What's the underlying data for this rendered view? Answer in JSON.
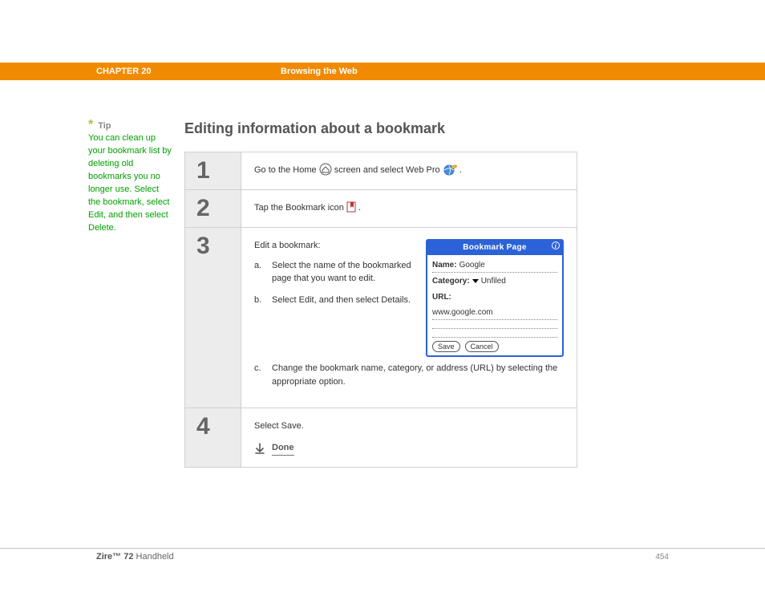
{
  "header": {
    "chapter": "CHAPTER 20",
    "section": "Browsing the Web"
  },
  "tip": {
    "label": "Tip",
    "body": "You can clean up your bookmark list by deleting old bookmarks you no longer use. Select the bookmark, select Edit, and then select Delete."
  },
  "title": "Editing information about a bookmark",
  "steps": {
    "s1": {
      "num": "1",
      "before": "Go to the Home ",
      "after1": " screen and select Web Pro ",
      "after2": "."
    },
    "s2": {
      "num": "2",
      "before": "Tap the Bookmark icon ",
      "after": "."
    },
    "s3": {
      "num": "3",
      "intro": "Edit a bookmark:",
      "a": {
        "lbl": "a.",
        "txt": "Select the name of the bookmarked page that you want to edit."
      },
      "b": {
        "lbl": "b.",
        "txt": "Select Edit, and then select Details."
      },
      "c": {
        "lbl": "c.",
        "txt": "Change the bookmark name, category, or address (URL) by selecting the appropriate option."
      }
    },
    "s4": {
      "num": "4",
      "text": "Select Save.",
      "done": "Done"
    }
  },
  "dialog": {
    "title": "Bookmark Page",
    "name_label": "Name:",
    "name_value": "Google",
    "category_label": "Category:",
    "category_value": "Unfiled",
    "url_label": "URL:",
    "url_value": "www.google.com",
    "save": "Save",
    "cancel": "Cancel"
  },
  "footer": {
    "brand": "Zire™ 72",
    "suffix": " Handheld",
    "page": "454"
  }
}
